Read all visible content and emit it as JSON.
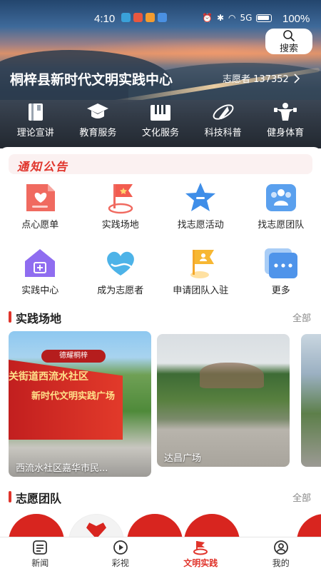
{
  "status_bar": {
    "time": "4:10",
    "battery_pct": "100%",
    "signal": "5G"
  },
  "header": {
    "search_label": "搜索",
    "center_title": "桐梓县新时代文明实践中心",
    "volunteer_text": "志愿者 137352"
  },
  "hero_nav": [
    {
      "label": "理论宣讲",
      "icon": "book-icon"
    },
    {
      "label": "教育服务",
      "icon": "graduation-cap-icon"
    },
    {
      "label": "文化服务",
      "icon": "piano-icon"
    },
    {
      "label": "科技科普",
      "icon": "rocket-icon"
    },
    {
      "label": "健身体育",
      "icon": "fitness-icon"
    }
  ],
  "notice": {
    "label": "通知公告"
  },
  "grid": [
    {
      "label": "点心愿单",
      "icon": "wish-list-icon"
    },
    {
      "label": "实践场地",
      "icon": "flag-location-icon"
    },
    {
      "label": "找志愿活动",
      "icon": "star-icon"
    },
    {
      "label": "找志愿团队",
      "icon": "team-icon"
    },
    {
      "label": "实践中心",
      "icon": "house-icon"
    },
    {
      "label": "成为志愿者",
      "icon": "heart-hand-icon"
    },
    {
      "label": "申请团队入驻",
      "icon": "flag-team-icon"
    },
    {
      "label": "更多",
      "icon": "more-icon"
    }
  ],
  "practice_sites": {
    "title": "实践场地",
    "more": "全部",
    "cards": [
      {
        "caption": "西流水社区嘉华市民...",
        "sign_top": "关街道西流水社区",
        "sign_main": "新时代文明实践广场",
        "sign_logo": "德耀桐梓"
      },
      {
        "caption": "达昌广场"
      },
      {
        "caption": ""
      }
    ]
  },
  "volunteer_teams": {
    "title": "志愿团队",
    "more": "全部"
  },
  "tabbar": [
    {
      "label": "新闻",
      "icon": "news-icon",
      "active": false
    },
    {
      "label": "彩视",
      "icon": "play-icon",
      "active": false
    },
    {
      "label": "文明实践",
      "icon": "civilization-icon",
      "active": true
    },
    {
      "label": "我的",
      "icon": "profile-icon",
      "active": false
    }
  ],
  "colors": {
    "accent": "#e0342b",
    "notice_bg": "#fbf1f1"
  }
}
